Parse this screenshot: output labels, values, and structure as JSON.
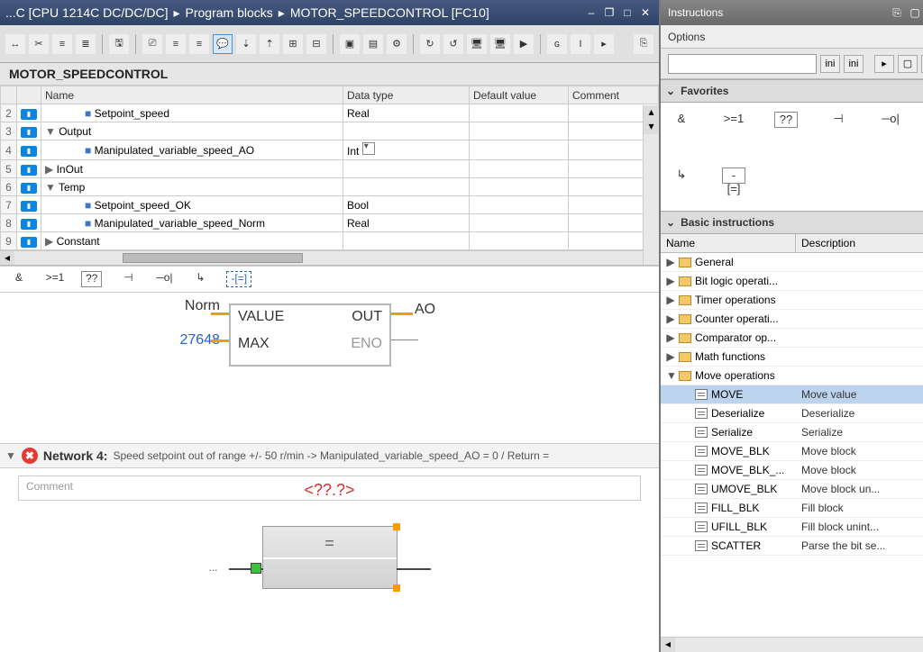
{
  "titlebar": {
    "crumb1": "...C [CPU 1214C DC/DC/DC]",
    "sep": "▸",
    "crumb2": "Program blocks",
    "crumb3": "MOTOR_SPEEDCONTROL [FC10]"
  },
  "block_header": "MOTOR_SPEEDCONTROL",
  "var_cols": {
    "name": "Name",
    "dtype": "Data type",
    "defval": "Default value",
    "comment": "Comment"
  },
  "vars": [
    {
      "n": "2",
      "kind": "param",
      "indent": 2,
      "name": "Setpoint_speed",
      "dtype": "Real"
    },
    {
      "n": "3",
      "kind": "section",
      "tri": "▼",
      "indent": 0,
      "name": "Output",
      "dtype": ""
    },
    {
      "n": "4",
      "kind": "param",
      "indent": 2,
      "name": "Manipulated_variable_speed_AO",
      "dtype": "Int",
      "dropdown": true
    },
    {
      "n": "5",
      "kind": "section",
      "tri": "▶",
      "indent": 0,
      "name": "InOut",
      "dtype": ""
    },
    {
      "n": "6",
      "kind": "section",
      "tri": "▼",
      "indent": 0,
      "name": "Temp",
      "dtype": ""
    },
    {
      "n": "7",
      "kind": "param",
      "indent": 2,
      "name": "Setpoint_speed_OK",
      "dtype": "Bool"
    },
    {
      "n": "8",
      "kind": "param",
      "indent": 2,
      "name": "Manipulated_variable_speed_Norm",
      "dtype": "Real"
    },
    {
      "n": "9",
      "kind": "section",
      "tri": "▶",
      "indent": 0,
      "name": "Constant",
      "dtype": ""
    }
  ],
  "favbar": {
    "and": "&",
    "ge": ">=1",
    "q": "??",
    "not": "⊣",
    "coil": "─o|",
    "jmp": "↳",
    "assign": "-[=]"
  },
  "block": {
    "top_lbl": "Norm",
    "pin_value": "VALUE",
    "pin_max": "MAX",
    "max_val": "27648",
    "pin_out": "OUT",
    "pin_eno": "ENO",
    "out_lbl": "AO"
  },
  "net4": {
    "title": "Network 4:",
    "desc": "Speed setpoint out of range +/- 50 r/min -> Manipulated_variable_speed_AO = 0 / Return =",
    "comment_ph": "Comment",
    "err_text": "<??.?>",
    "eq": "="
  },
  "panel": {
    "title": "Instructions",
    "options": "Options",
    "fav_hdr": "Favorites",
    "basic_hdr": "Basic instructions",
    "col_name": "Name",
    "col_desc": "Description"
  },
  "fav_panel": {
    "and": "&",
    "ge": ">=1",
    "q": "??",
    "not": "⊣",
    "coil": "─o|",
    "jmp": "↳",
    "assign": "-[=]"
  },
  "instr": [
    {
      "type": "folder",
      "tri": "▶",
      "name": "General",
      "desc": ""
    },
    {
      "type": "folder",
      "tri": "▶",
      "name": "Bit logic operati...",
      "desc": ""
    },
    {
      "type": "folder",
      "tri": "▶",
      "name": "Timer operations",
      "desc": "",
      "icon": "timer"
    },
    {
      "type": "folder",
      "tri": "▶",
      "name": "Counter operati...",
      "desc": "",
      "icon": "counter"
    },
    {
      "type": "folder",
      "tri": "▶",
      "name": "Comparator op...",
      "desc": "",
      "icon": "cmp"
    },
    {
      "type": "folder",
      "tri": "▶",
      "name": "Math functions",
      "desc": "",
      "icon": "math"
    },
    {
      "type": "folder",
      "tri": "▼",
      "name": "Move operations",
      "desc": ""
    },
    {
      "type": "item",
      "name": "MOVE",
      "desc": "Move value",
      "sel": true
    },
    {
      "type": "item",
      "name": "Deserialize",
      "desc": "Deserialize"
    },
    {
      "type": "item",
      "name": "Serialize",
      "desc": "Serialize"
    },
    {
      "type": "item",
      "name": "MOVE_BLK",
      "desc": "Move block"
    },
    {
      "type": "item",
      "name": "MOVE_BLK_...",
      "desc": "Move block"
    },
    {
      "type": "item",
      "name": "UMOVE_BLK",
      "desc": "Move block un..."
    },
    {
      "type": "item",
      "name": "FILL_BLK",
      "desc": "Fill block"
    },
    {
      "type": "item",
      "name": "UFILL_BLK",
      "desc": "Fill block unint..."
    },
    {
      "type": "item",
      "name": "SCATTER",
      "desc": "Parse the bit se..."
    }
  ]
}
